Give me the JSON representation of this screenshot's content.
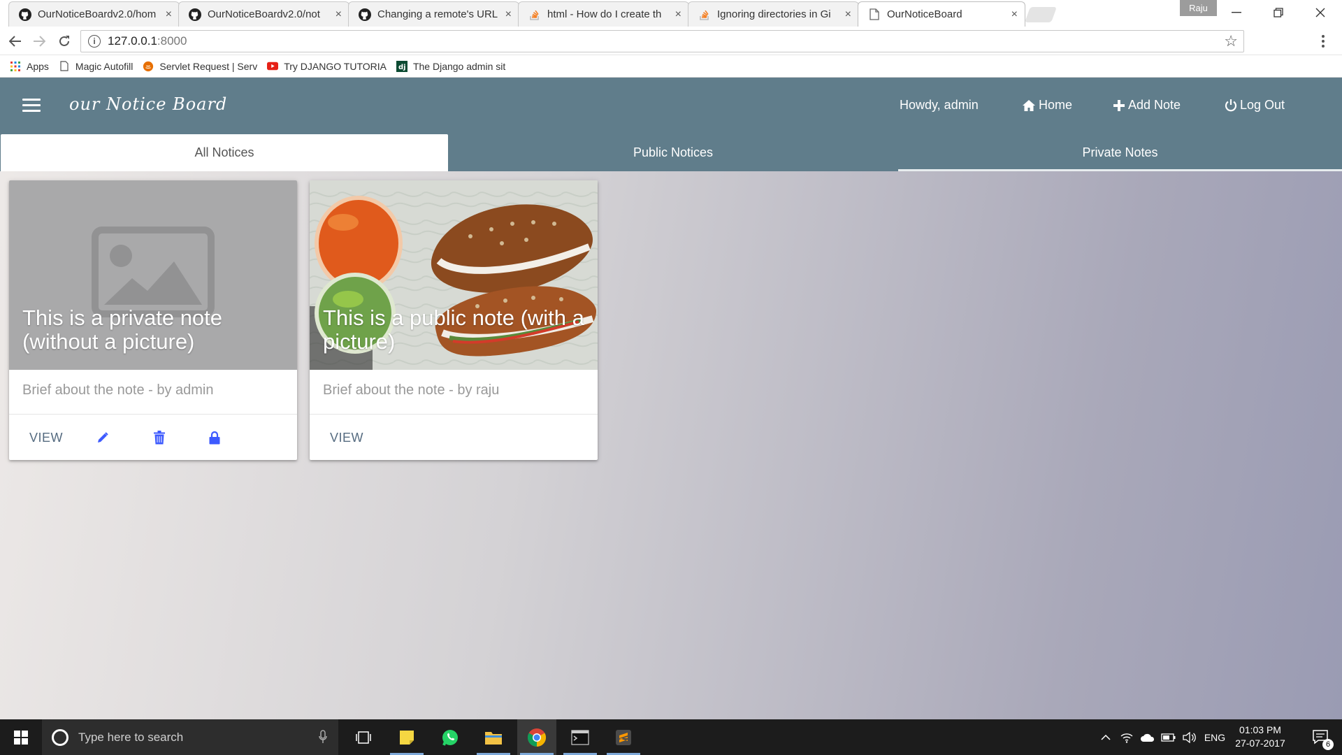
{
  "browser": {
    "tabs": [
      {
        "title": "OurNoticeBoardv2.0/hom",
        "icon": "github-icon"
      },
      {
        "title": "OurNoticeBoardv2.0/not",
        "icon": "github-icon"
      },
      {
        "title": "Changing a remote's URL",
        "icon": "github-icon"
      },
      {
        "title": "html - How do I create th",
        "icon": "stackoverflow-icon"
      },
      {
        "title": "Ignoring directories in Gi",
        "icon": "stackoverflow-icon"
      },
      {
        "title": "OurNoticeBoard",
        "icon": "page-icon"
      }
    ],
    "tab_close": "×",
    "profile_name": "Raju",
    "url_host": "127.0.0.1",
    "url_port": ":8000",
    "bookmarks": [
      {
        "label": "Apps",
        "icon": "apps-grid-icon"
      },
      {
        "label": "Magic Autofill",
        "icon": "page-icon"
      },
      {
        "label": "Servlet Request | Serv",
        "icon": "java-icon"
      },
      {
        "label": "Try DJANGO TUTORIA",
        "icon": "youtube-icon"
      },
      {
        "label": "The Django admin sit",
        "icon": "django-icon"
      }
    ]
  },
  "app": {
    "brand": "our Notice Board",
    "nav": {
      "greeting": "Howdy, admin",
      "home": "Home",
      "add_note": "Add Note",
      "logout": "Log Out"
    },
    "tabs": [
      "All Notices",
      "Public Notices",
      "Private Notes"
    ],
    "active_tab": "All Notices",
    "colors": {
      "appbar": "#607d8b",
      "action_icon": "#3d5afe",
      "view_link": "#556b80"
    },
    "cards": [
      {
        "title": "This is a private note (without a picture)",
        "brief": "Brief about the note - by admin",
        "view_label": "VIEW",
        "image": "placeholder-image",
        "actions": [
          "edit-icon",
          "delete-icon",
          "lock-icon"
        ]
      },
      {
        "title": "This is a public note (with a picture)",
        "brief": "Brief about the note - by raju",
        "view_label": "VIEW",
        "image": "food-photo"
      }
    ]
  },
  "taskbar": {
    "search_placeholder": "Type here to search",
    "language": "ENG",
    "time": "01:03 PM",
    "date": "27-07-2017",
    "notification_count": "6"
  }
}
